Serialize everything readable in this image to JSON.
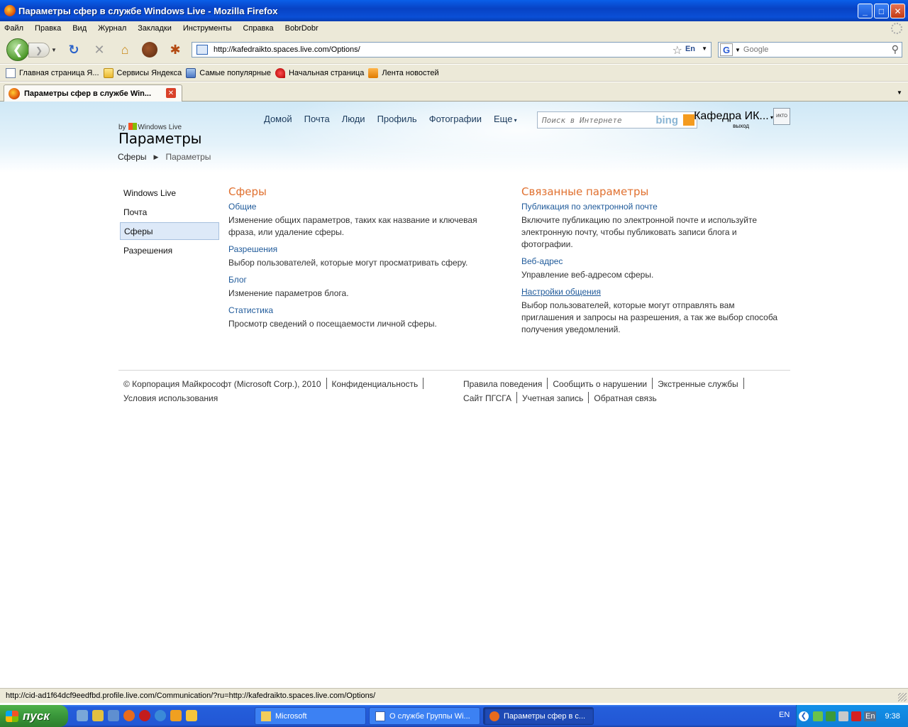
{
  "window": {
    "title": "Параметры сфер в службе Windows Live - Mozilla Firefox",
    "buttons": {
      "minimize": "_",
      "maximize": "□",
      "close": "✕"
    }
  },
  "menu": [
    "Файл",
    "Правка",
    "Вид",
    "Журнал",
    "Закладки",
    "Инструменты",
    "Справка",
    "BobrDobr"
  ],
  "nav": {
    "url": "http://kafedraikto.spaces.live.com/Options/",
    "lang_badge": "En",
    "search_placeholder": "Google"
  },
  "bookmarks": [
    {
      "label": "Главная страница Я...",
      "icon": "page-icon"
    },
    {
      "label": "Сервисы Яндекса",
      "icon": "folder-icon"
    },
    {
      "label": "Самые популярные",
      "icon": "popular-icon"
    },
    {
      "label": "Начальная страница",
      "icon": "start-icon"
    },
    {
      "label": "Лента новостей",
      "icon": "rss-icon"
    }
  ],
  "tab": {
    "label": "Параметры сфер в службе Win..."
  },
  "page": {
    "topnav": [
      "Домой",
      "Почта",
      "Люди",
      "Профиль",
      "Фотографии",
      "Еще"
    ],
    "web_search_placeholder": "Поиск в Интернете",
    "bing_label": "bing",
    "user": {
      "name": "Кафедра ИК...",
      "logout": "выход",
      "avatar_label": "ИКТО"
    },
    "brand": {
      "by": "by",
      "product": "Windows Live",
      "title": "Параметры"
    },
    "breadcrumb": [
      "Сферы",
      "Параметры"
    ],
    "leftnav": [
      {
        "label": "Windows Live",
        "selected": false
      },
      {
        "label": "Почта",
        "selected": false
      },
      {
        "label": "Сферы",
        "selected": true
      },
      {
        "label": "Разрешения",
        "selected": false
      }
    ],
    "left_column": {
      "heading": "Сферы",
      "sections": [
        {
          "link": "Общие",
          "desc": "Изменение общих параметров, таких как название и ключевая фраза, или удаление сферы."
        },
        {
          "link": "Разрешения",
          "desc": "Выбор пользователей, которые могут просматривать сферу."
        },
        {
          "link": "Блог",
          "desc": "Изменение параметров блога."
        },
        {
          "link": "Статистика",
          "desc": "Просмотр сведений о посещаемости личной сферы."
        }
      ]
    },
    "right_column": {
      "heading": "Связанные параметры",
      "sections": [
        {
          "link": "Публикация по электронной почте",
          "desc": "Включите публикацию по электронной почте и используйте электронную почту, чтобы публиковать записи блога и фотографии."
        },
        {
          "link": "Веб-адрес",
          "desc": "Управление веб-адресом сферы."
        },
        {
          "link": "Настройки общения",
          "desc": "Выбор пользователей, которые могут отправлять вам приглашения и запросы на разрешения, а так же выбор способа получения уведомлений."
        }
      ]
    },
    "footer": {
      "copyright": "© Корпорация Майкрософт (Microsoft Corp.), 2010",
      "privacy": "Конфиденциальность",
      "terms": "Условия использования",
      "conduct": "Правила поведения",
      "report": "Сообщить о нарушении",
      "emergency": "Экстренные службы",
      "site": "Сайт ПГСГА",
      "account": "Учетная запись",
      "feedback": "Обратная связь"
    }
  },
  "status": "http://cid-ad1f64dcf9eedfbd.profile.live.com/Communication/?ru=http://kafedraikto.spaces.live.com/Options/",
  "taskbar": {
    "start": "пуск",
    "tasks": [
      {
        "label": "Microsoft",
        "active": false
      },
      {
        "label": "О службе Группы Wi...",
        "active": false
      },
      {
        "label": "Параметры сфер в с...",
        "active": true
      }
    ],
    "lang": "EN",
    "tray_lang": "En",
    "clock": "9:38"
  }
}
